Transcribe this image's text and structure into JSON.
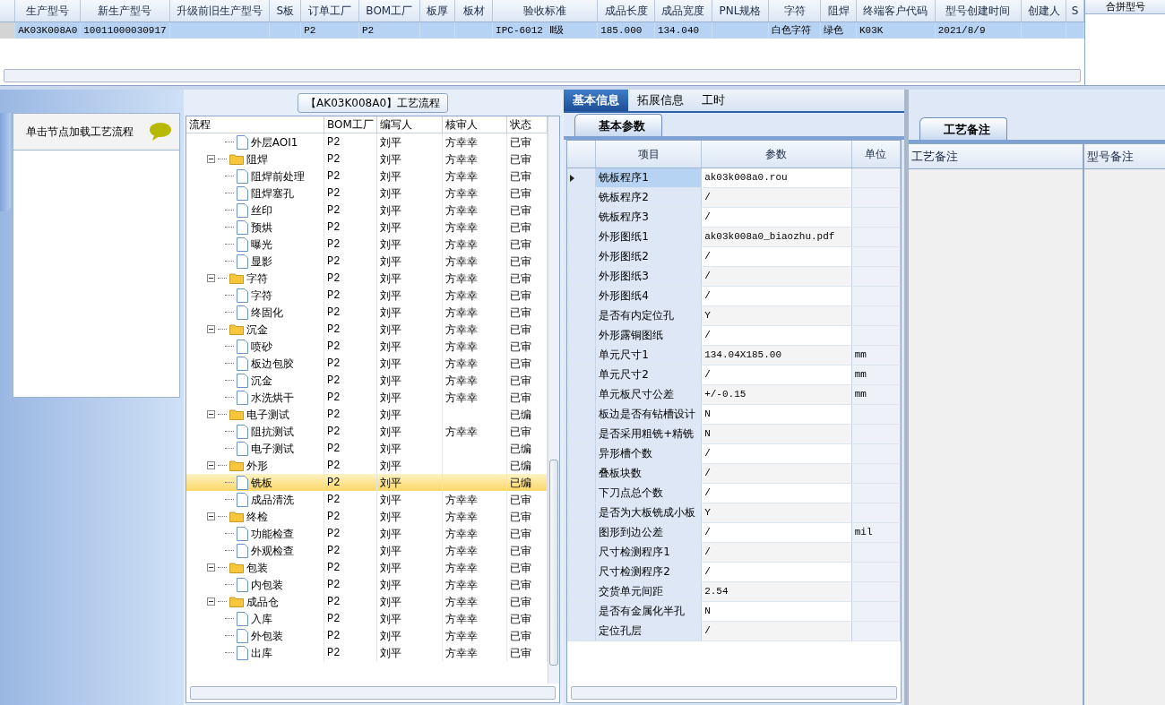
{
  "model_table": {
    "columns": [
      "生产型号",
      "新生产型号",
      "升级前旧生产型号",
      "S板",
      "订单工厂",
      "BOM工厂",
      "板厚",
      "板材",
      "验收标准",
      "成品长度",
      "成品宽度",
      "PNL规格",
      "字符",
      "阻焊",
      "终端客户代码",
      "型号创建时间",
      "创建人",
      "S"
    ],
    "rows": [
      {
        "selected": true,
        "cells": [
          "AK03K008A0",
          "10011000030917",
          "",
          "",
          "P2",
          "P2",
          "",
          "",
          "IPC-6012 Ⅱ级",
          "185.000",
          "134.040",
          "",
          "白色字符",
          "绿色",
          "K03K",
          "2021/8/9",
          "",
          ""
        ]
      }
    ]
  },
  "merge_panel": {
    "column": "合拼型号"
  },
  "side_panel": {
    "hint": "单击节点加载工艺流程"
  },
  "flow_panel": {
    "title": "【AK03K008A0】工艺流程",
    "columns": [
      "流程",
      "BOM工厂",
      "编写人",
      "核审人",
      "状态"
    ],
    "nodes": [
      {
        "kind": "file",
        "label": "外层AOI1",
        "bom": "P2",
        "writer": "刘平",
        "reviewer": "方幸幸",
        "status": "已审",
        "selected": false
      },
      {
        "kind": "folder",
        "label": "阻焊",
        "bom": "P2",
        "writer": "刘平",
        "reviewer": "方幸幸",
        "status": "已审",
        "selected": false,
        "expanded": true,
        "children": [
          {
            "kind": "file",
            "label": "阻焊前处理",
            "bom": "P2",
            "writer": "刘平",
            "reviewer": "方幸幸",
            "status": "已审",
            "selected": false
          },
          {
            "kind": "file",
            "label": "阻焊塞孔",
            "bom": "P2",
            "writer": "刘平",
            "reviewer": "方幸幸",
            "status": "已审",
            "selected": false
          },
          {
            "kind": "file",
            "label": "丝印",
            "bom": "P2",
            "writer": "刘平",
            "reviewer": "方幸幸",
            "status": "已审",
            "selected": false
          },
          {
            "kind": "file",
            "label": "预烘",
            "bom": "P2",
            "writer": "刘平",
            "reviewer": "方幸幸",
            "status": "已审",
            "selected": false
          },
          {
            "kind": "file",
            "label": "曝光",
            "bom": "P2",
            "writer": "刘平",
            "reviewer": "方幸幸",
            "status": "已审",
            "selected": false
          },
          {
            "kind": "file",
            "label": "显影",
            "bom": "P2",
            "writer": "刘平",
            "reviewer": "方幸幸",
            "status": "已审",
            "selected": false
          }
        ]
      },
      {
        "kind": "folder",
        "label": "字符",
        "bom": "P2",
        "writer": "刘平",
        "reviewer": "方幸幸",
        "status": "已审",
        "selected": false,
        "expanded": true,
        "children": [
          {
            "kind": "file",
            "label": "字符",
            "bom": "P2",
            "writer": "刘平",
            "reviewer": "方幸幸",
            "status": "已审",
            "selected": false
          },
          {
            "kind": "file",
            "label": "终固化",
            "bom": "P2",
            "writer": "刘平",
            "reviewer": "方幸幸",
            "status": "已审",
            "selected": false
          }
        ]
      },
      {
        "kind": "folder",
        "label": "沉金",
        "bom": "P2",
        "writer": "刘平",
        "reviewer": "方幸幸",
        "status": "已审",
        "selected": false,
        "expanded": true,
        "children": [
          {
            "kind": "file",
            "label": "喷砂",
            "bom": "P2",
            "writer": "刘平",
            "reviewer": "方幸幸",
            "status": "已审",
            "selected": false
          },
          {
            "kind": "file",
            "label": "板边包胶",
            "bom": "P2",
            "writer": "刘平",
            "reviewer": "方幸幸",
            "status": "已审",
            "selected": false
          },
          {
            "kind": "file",
            "label": "沉金",
            "bom": "P2",
            "writer": "刘平",
            "reviewer": "方幸幸",
            "status": "已审",
            "selected": false
          },
          {
            "kind": "file",
            "label": "水洗烘干",
            "bom": "P2",
            "writer": "刘平",
            "reviewer": "方幸幸",
            "status": "已审",
            "selected": false
          }
        ]
      },
      {
        "kind": "folder",
        "label": "电子测试",
        "bom": "P2",
        "writer": "刘平",
        "status": "已编",
        "selected": false,
        "expanded": true,
        "children": [
          {
            "kind": "file",
            "label": "阻抗测试",
            "bom": "P2",
            "writer": "刘平",
            "reviewer": "方幸幸",
            "status": "已审",
            "selected": false
          },
          {
            "kind": "file",
            "label": "电子测试",
            "bom": "P2",
            "writer": "刘平",
            "status": "已编",
            "selected": false
          }
        ]
      },
      {
        "kind": "folder",
        "label": "外形",
        "bom": "P2",
        "writer": "刘平",
        "status": "已编",
        "selected": false,
        "expanded": true,
        "children": [
          {
            "kind": "file",
            "label": "铣板",
            "bom": "P2",
            "writer": "刘平",
            "status": "已编",
            "selected": true
          },
          {
            "kind": "file",
            "label": "成品清洗",
            "bom": "P2",
            "writer": "刘平",
            "reviewer": "方幸幸",
            "status": "已审",
            "selected": false
          }
        ]
      },
      {
        "kind": "folder",
        "label": "终检",
        "bom": "P2",
        "writer": "刘平",
        "reviewer": "方幸幸",
        "status": "已审",
        "selected": false,
        "expanded": true,
        "children": [
          {
            "kind": "file",
            "label": "功能检查",
            "bom": "P2",
            "writer": "刘平",
            "reviewer": "方幸幸",
            "status": "已审",
            "selected": false
          },
          {
            "kind": "file",
            "label": "外观检查",
            "bom": "P2",
            "writer": "刘平",
            "reviewer": "方幸幸",
            "status": "已审",
            "selected": false
          }
        ]
      },
      {
        "kind": "folder",
        "label": "包装",
        "bom": "P2",
        "writer": "刘平",
        "reviewer": "方幸幸",
        "status": "已审",
        "selected": false,
        "expanded": true,
        "children": [
          {
            "kind": "file",
            "label": "内包装",
            "bom": "P2",
            "writer": "刘平",
            "reviewer": "方幸幸",
            "status": "已审",
            "selected": false
          }
        ]
      },
      {
        "kind": "folder",
        "label": "成品仓",
        "bom": "P2",
        "writer": "刘平",
        "reviewer": "方幸幸",
        "status": "已审",
        "selected": false,
        "expanded": true,
        "children": [
          {
            "kind": "file",
            "label": "入库",
            "bom": "P2",
            "writer": "刘平",
            "reviewer": "方幸幸",
            "status": "已审",
            "selected": false
          },
          {
            "kind": "file",
            "label": "外包装",
            "bom": "P2",
            "writer": "刘平",
            "reviewer": "方幸幸",
            "status": "已审",
            "selected": false
          },
          {
            "kind": "file",
            "label": "出库",
            "bom": "P2",
            "writer": "刘平",
            "reviewer": "方幸幸",
            "status": "已审",
            "selected": false
          }
        ]
      }
    ]
  },
  "info_panel": {
    "tabs": [
      {
        "label": "基本信息",
        "selected": true
      },
      {
        "label": "拓展信息",
        "selected": false
      },
      {
        "label": "工时",
        "selected": false
      }
    ],
    "subtab": "基本参数",
    "columns": [
      "项目",
      "参数",
      "单位"
    ],
    "rows": [
      {
        "item": "铣板程序1",
        "value": "ak03k008a0.rou",
        "unit": "",
        "selected": true
      },
      {
        "item": "铣板程序2",
        "value": "/",
        "unit": "",
        "selected": false
      },
      {
        "item": "铣板程序3",
        "value": "/",
        "unit": "",
        "selected": false
      },
      {
        "item": "外形图纸1",
        "value": "ak03k008a0_biaozhu.pdf",
        "unit": "",
        "selected": false
      },
      {
        "item": "外形图纸2",
        "value": "/",
        "unit": "",
        "selected": false
      },
      {
        "item": "外形图纸3",
        "value": "/",
        "unit": "",
        "selected": false
      },
      {
        "item": "外形图纸4",
        "value": "/",
        "unit": "",
        "selected": false
      },
      {
        "item": "是否有内定位孔",
        "value": "Y",
        "unit": "",
        "selected": false
      },
      {
        "item": "外形露铜图纸",
        "value": "/",
        "unit": "",
        "selected": false
      },
      {
        "item": "单元尺寸1",
        "value": "134.04X185.00",
        "unit": "mm",
        "selected": false
      },
      {
        "item": "单元尺寸2",
        "value": "/",
        "unit": "mm",
        "selected": false
      },
      {
        "item": "单元板尺寸公差",
        "value": "+/-0.15",
        "unit": "mm",
        "selected": false
      },
      {
        "item": "板边是否有钻槽设计",
        "value": "N",
        "unit": "",
        "selected": false
      },
      {
        "item": "是否采用粗铣+精铣",
        "value": "N",
        "unit": "",
        "selected": false
      },
      {
        "item": "异形槽个数",
        "value": "/",
        "unit": "",
        "selected": false
      },
      {
        "item": "叠板块数",
        "value": "/",
        "unit": "",
        "selected": false
      },
      {
        "item": "下刀点总个数",
        "value": "/",
        "unit": "",
        "selected": false
      },
      {
        "item": "是否为大板铣成小板",
        "value": "Y",
        "unit": "",
        "selected": false
      },
      {
        "item": "图形到边公差",
        "value": "/",
        "unit": "mil",
        "selected": false
      },
      {
        "item": "尺寸检测程序1",
        "value": "/",
        "unit": "",
        "selected": false
      },
      {
        "item": "尺寸检测程序2",
        "value": "/",
        "unit": "",
        "selected": false
      },
      {
        "item": "交货单元间距",
        "value": "2.54",
        "unit": "",
        "selected": false
      },
      {
        "item": "是否有金属化半孔",
        "value": "N",
        "unit": "",
        "selected": false
      },
      {
        "item": "定位孔层",
        "value": "/",
        "unit": "",
        "selected": false
      }
    ]
  },
  "remarks_panel": {
    "tab": "工艺备注",
    "columns": [
      "工艺备注",
      "型号备注"
    ]
  }
}
